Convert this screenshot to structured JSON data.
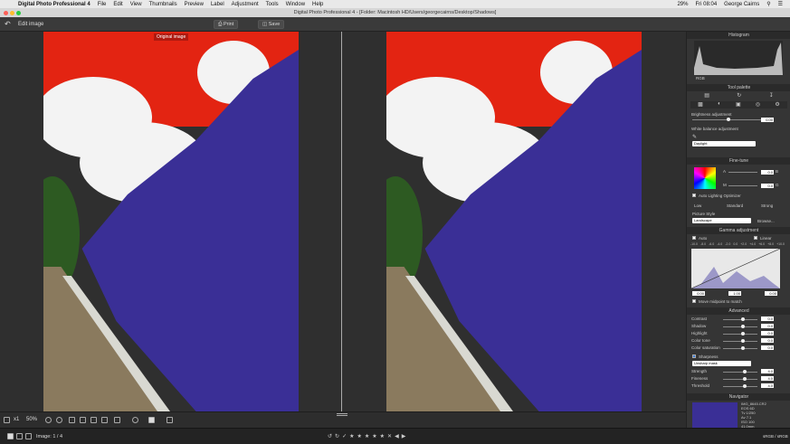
{
  "menubar": {
    "app": "Digital Photo Professional 4",
    "items": [
      "File",
      "Edit",
      "View",
      "Thumbnails",
      "Preview",
      "Label",
      "Adjustment",
      "Tools",
      "Window",
      "Help"
    ],
    "clock": "Fri 08:04",
    "user": "George Cairns",
    "volume": "29%"
  },
  "window": {
    "title": "Digital Photo Professional 4 - [Folder: Macintosh HD/Users/georgecairns/Desktop/Shadows]"
  },
  "toolbar": {
    "edit_image": "Edit image",
    "print": "Print",
    "save": "Save"
  },
  "left_image": {
    "badge": "Original image"
  },
  "histogram": {
    "title": "Histogram",
    "channels": "RGB"
  },
  "tool_palette": {
    "title": "Tool palette",
    "brightness_label": "Brightness adjustment",
    "brightness_value": "0.00",
    "wb_label": "White balance adjustment",
    "wb_value": "Daylight"
  },
  "fine_tune": {
    "title": "Fine-tune",
    "a_label": "A",
    "a_value": "0.0",
    "m_label": "M",
    "m_value": "0.0",
    "b_label": "B",
    "b_value": "0.0",
    "g_label": "G",
    "g_value": "0.0",
    "alo_label": "Auto Lighting Optimizer",
    "alo_low": "Low",
    "alo_std": "Standard",
    "alo_strong": "Strong",
    "ps_label": "Picture Style",
    "ps_value": "Landscape",
    "browse": "Browse..."
  },
  "gamma": {
    "title": "Gamma adjustment",
    "auto": "Auto",
    "linear": "Linear",
    "ticks": [
      "-10.0",
      "-8.0",
      "-6.0",
      "-4.0",
      "-2.0",
      "0.0",
      "+2.0",
      "+4.0",
      "+6.0",
      "+8.0",
      "+10.0"
    ],
    "low": "0.00",
    "mid": "1.00",
    "high": "0.00",
    "move_label": "Move midpoint to match"
  },
  "advanced": {
    "title": "Advanced",
    "rows": [
      {
        "label": "Contrast",
        "value": "0.0"
      },
      {
        "label": "Shadow",
        "value": "0.0"
      },
      {
        "label": "Highlight",
        "value": "0.0"
      },
      {
        "label": "Color tone",
        "value": "0.0"
      },
      {
        "label": "Color saturation",
        "value": "0.0"
      }
    ],
    "sharpness_label": "Sharpness",
    "unsharp": "Unsharp mask",
    "sharp_rows": [
      {
        "label": "Strength",
        "value": "4.0"
      },
      {
        "label": "Fineness",
        "value": "4.0"
      },
      {
        "label": "Threshold",
        "value": "4.0"
      }
    ]
  },
  "navigator": {
    "title": "Navigator",
    "info": [
      "IMG_8645.CR2",
      "EOS 6D",
      "Tv 1/250",
      "Av 7.1",
      "ISO 100",
      "41.0mm"
    ],
    "colorspace": "sRGB / sRGB"
  },
  "bottombar": {
    "x1": "x1",
    "zoom": "50%"
  },
  "statusbar": {
    "image_count": "Image: 1 / 4"
  },
  "colors": {
    "sky": "#e32412",
    "train": "#3a2f96",
    "panel": "#353535"
  }
}
